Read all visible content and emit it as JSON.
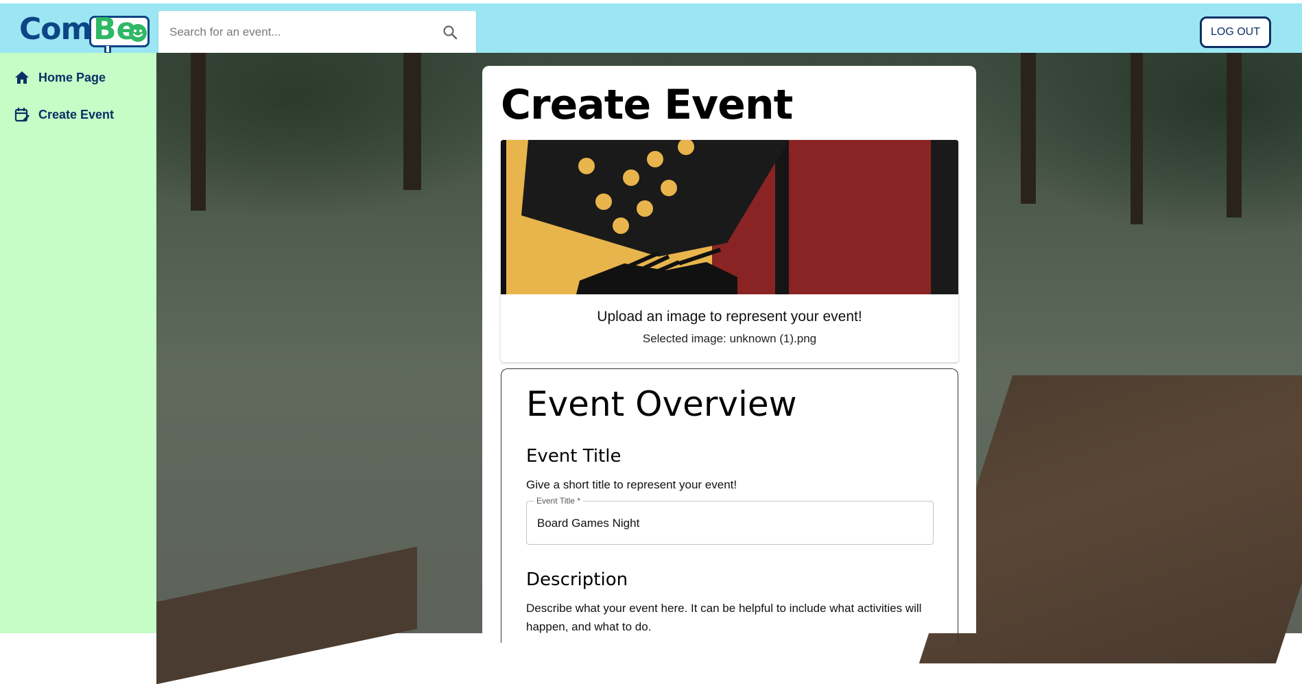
{
  "header": {
    "logo": {
      "part1": "Com",
      "part2": "Be"
    },
    "search": {
      "placeholder": "Search for an event..."
    },
    "logout_label": "LOG OUT"
  },
  "sidebar": {
    "items": [
      {
        "label": "Home Page",
        "icon": "home-icon"
      },
      {
        "label": "Create Event",
        "icon": "calendar-edit-icon"
      }
    ]
  },
  "main": {
    "page_title": "Create Event",
    "upload": {
      "title": "Upload an image to represent your event!",
      "selected_file": "Selected image: unknown (1).png"
    },
    "overview": {
      "heading": "Event Overview",
      "title_section": {
        "heading": "Event Title",
        "help": "Give a short title to represent your event!",
        "field_label": "Event Title *",
        "value": "Board Games Night"
      },
      "description_section": {
        "heading": "Description",
        "help": "Describe what your event here. It can be helpful to include what activities will happen, and what to do."
      }
    }
  },
  "colors": {
    "topbar": "#9be6f2",
    "sidebar": "#c6fcc6",
    "brand_navy": "#0c2f66",
    "brand_green": "#2fb866"
  }
}
